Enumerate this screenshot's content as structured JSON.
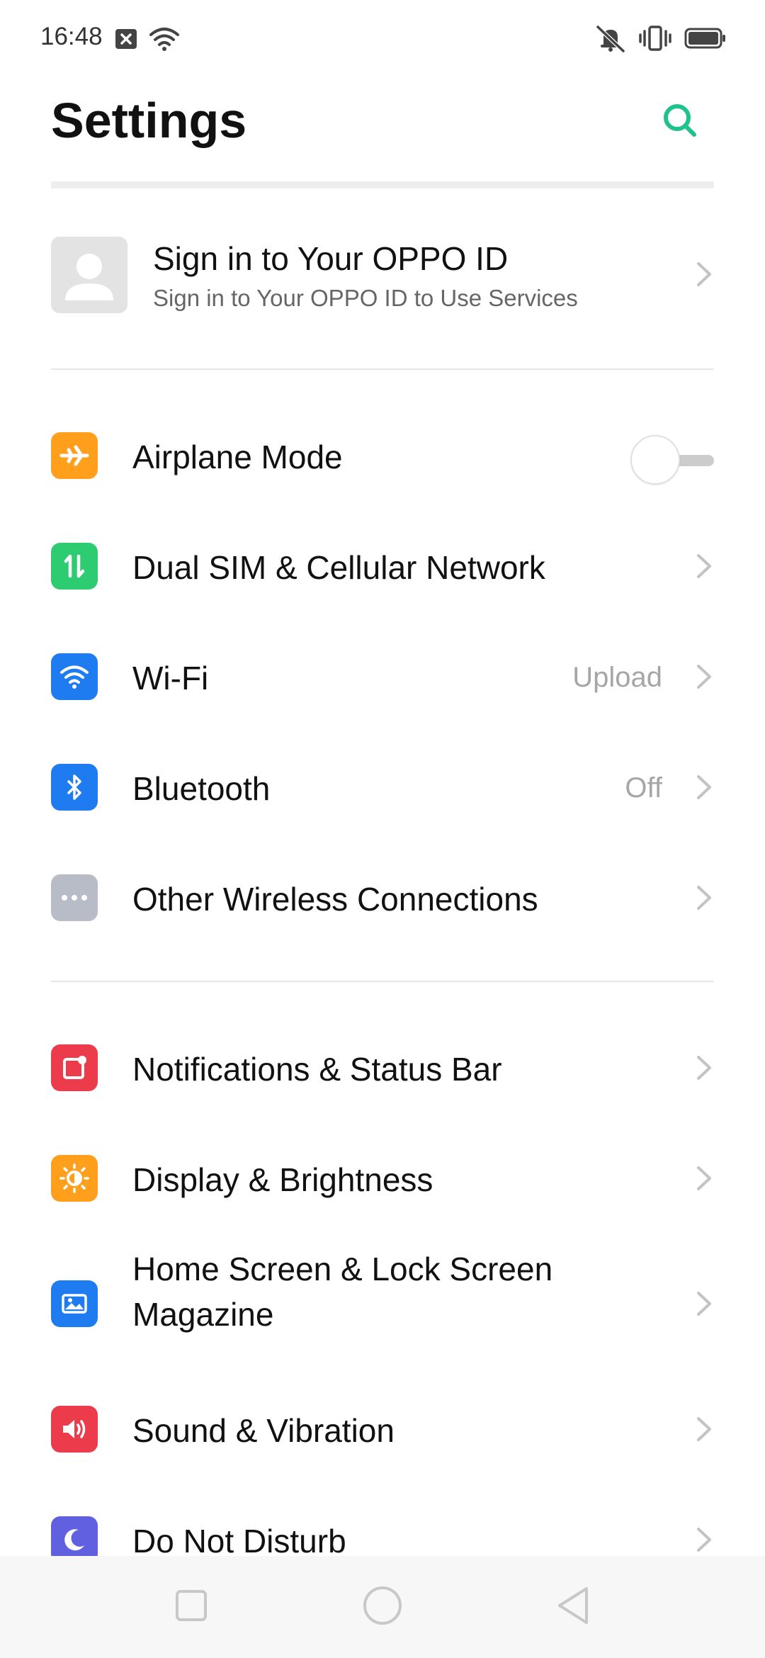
{
  "status_bar": {
    "time": "16:48",
    "icons": [
      "notification-x-icon",
      "wifi-icon",
      "muted-bell-icon",
      "vibrate-icon",
      "battery-icon"
    ]
  },
  "header": {
    "title": "Settings",
    "search_icon": "search-icon",
    "accent_color": "#1ec28b"
  },
  "account": {
    "title": "Sign in to Your OPPO ID",
    "subtitle": "Sign in to Your OPPO ID to Use Services"
  },
  "groups": {
    "connectivity": [
      {
        "label": "Airplane Mode",
        "icon": "airplane-icon",
        "color": "#ff9f1c",
        "toggle": true,
        "toggle_on": false
      },
      {
        "label": "Dual SIM & Cellular Network",
        "icon": "cellular-arrows-icon",
        "color": "#2ecc71"
      },
      {
        "label": "Wi-Fi",
        "icon": "wifi-icon",
        "color": "#1e7cf0",
        "value": "Upload"
      },
      {
        "label": "Bluetooth",
        "icon": "bluetooth-icon",
        "color": "#1e7cf0",
        "value": "Off"
      },
      {
        "label": "Other Wireless Connections",
        "icon": "more-dots-icon",
        "color": "#b8bcc6"
      }
    ],
    "device": [
      {
        "label": "Notifications & Status Bar",
        "icon": "notification-icon",
        "color": "#ec3b4b"
      },
      {
        "label": "Display & Brightness",
        "icon": "brightness-icon",
        "color": "#ff9f1c"
      },
      {
        "label": "Home Screen & Lock Screen Magazine",
        "icon": "wallpaper-icon",
        "color": "#1e7cf0"
      },
      {
        "label": "Sound & Vibration",
        "icon": "speaker-icon",
        "color": "#ec3b4b"
      },
      {
        "label": "Do Not Disturb",
        "icon": "moon-icon",
        "color": "#6060e0"
      }
    ]
  },
  "nav_bar": {
    "buttons": [
      "recent-apps-icon",
      "home-icon",
      "back-icon"
    ]
  }
}
